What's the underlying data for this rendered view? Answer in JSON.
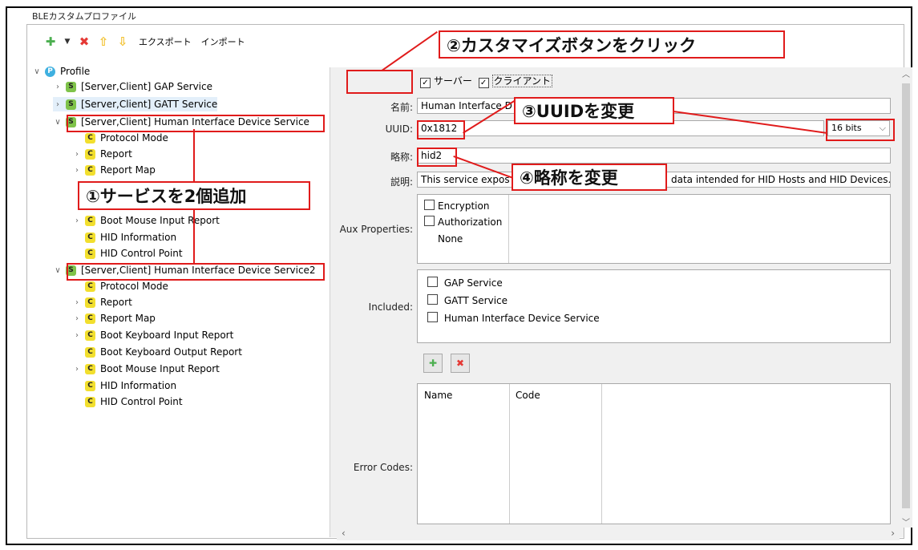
{
  "panel": {
    "title": "BLEカスタムプロファイル"
  },
  "toolbar": {
    "add_icon": "plus-icon",
    "dropdown_icon": "chevron-down-icon",
    "delete_icon": "delete-icon",
    "up_icon": "arrow-up-icon",
    "down_icon": "arrow-down-icon",
    "export_label": "エクスポート",
    "import_label": "インポート"
  },
  "tree": {
    "root": "Profile",
    "items": [
      "[Server,Client] GAP Service",
      "[Server,Client] GATT Service",
      "[Server,Client] Human Interface Device Service",
      "Protocol Mode",
      "Report",
      "Report Map",
      "Boot Mouse Input Report",
      "HID Information",
      "HID Control Point",
      "[Server,Client] Human Interface Device Service2",
      "Protocol Mode",
      "Report",
      "Report Map",
      "Boot Keyboard Input Report",
      "Boot Keyboard Output Report",
      "Boot Mouse Input Report",
      "HID Information",
      "HID Control Point"
    ]
  },
  "form": {
    "server_label": "サーバー",
    "client_label": "クライアント",
    "name_label": "名前:",
    "name_value": "Human Interface D",
    "uuid_label": "UUID:",
    "uuid_value": "0x1812",
    "uuid_bits": "16 bits",
    "abbrev_label": "略称:",
    "abbrev_value": "hid2",
    "desc_label": "説明:",
    "desc_value_left": "This service expos",
    "desc_value_right": "data intended for HID Hosts and HID Devices.",
    "aux_label": "Aux Properties:",
    "aux_items": [
      "Encryption",
      "Authorization",
      "None"
    ],
    "included_label": "Included:",
    "included_items": [
      "GAP Service",
      "GATT Service",
      "Human Interface Device Service"
    ],
    "errors_label": "Error Codes:",
    "errors_headers": [
      "Name",
      "Code"
    ]
  },
  "callouts": {
    "c1": "①サービスを2個追加",
    "c2": "②カスタマイズボタンをクリック",
    "c3": "③UUIDを変更",
    "c4": "④略称を変更"
  },
  "colors": {
    "accent": "#e01b1b",
    "service": "#7fc34a",
    "characteristic": "#f2df2e",
    "profile": "#3fb0e0"
  }
}
